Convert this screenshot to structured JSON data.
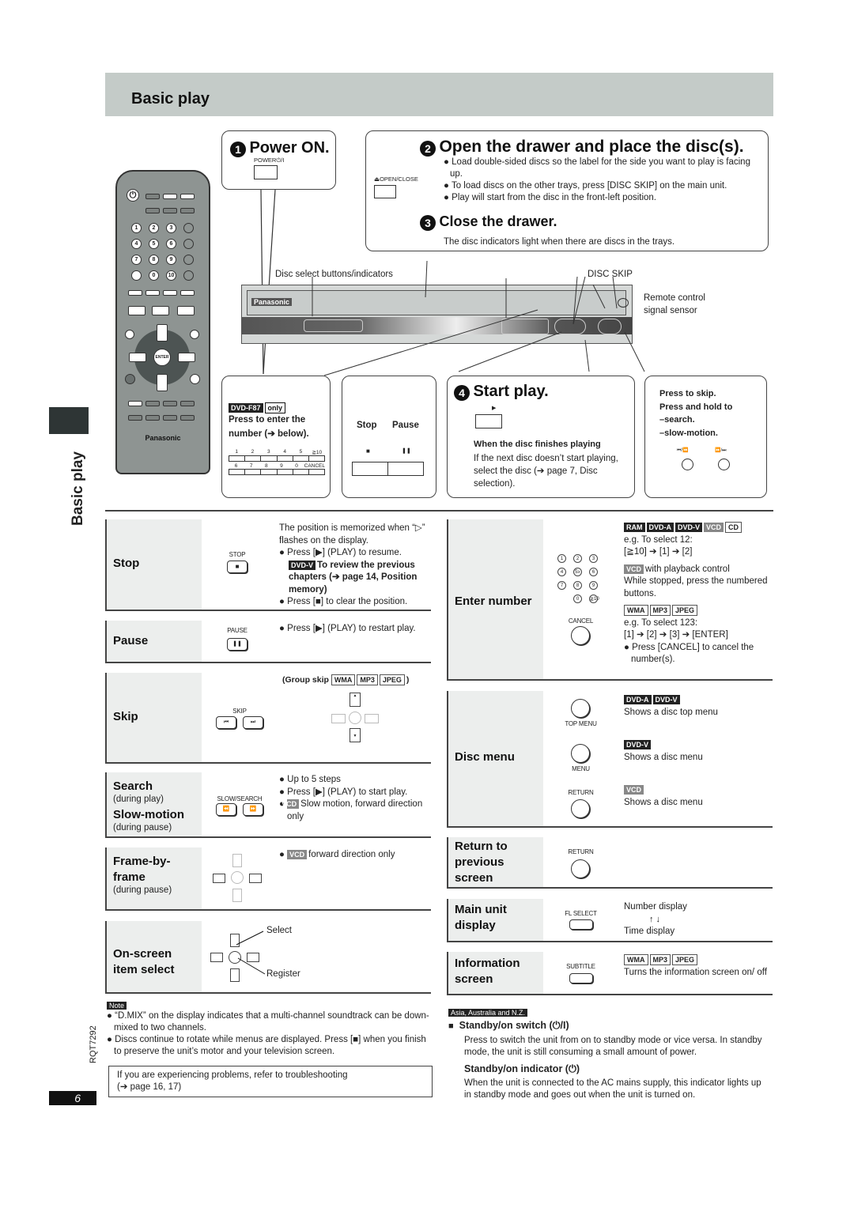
{
  "header": {
    "title": "Basic play"
  },
  "side_tab": {
    "label": "Basic play",
    "doc_code": "RQT7292",
    "page_number": "6"
  },
  "remote": {
    "brand": "Panasonic",
    "enter_label": "ENTER"
  },
  "step1": {
    "num": "1",
    "title": "Power ON.",
    "button_label": "POWER⏻/I"
  },
  "step2": {
    "num": "2",
    "title": "Open the drawer and place the disc(s).",
    "button_label": "⏏OPEN/CLOSE",
    "bullets": [
      "Load double-sided discs so the label for the side you want to play is facing up.",
      "To load discs on the other trays, press [DISC SKIP] on the main unit.",
      "Play will start from the disc in the front-left position."
    ]
  },
  "step3": {
    "num": "3",
    "title": "Close the drawer.",
    "text": "The disc indicators light when there are discs in the trays."
  },
  "unit": {
    "disc_select_label": "Disc select buttons/indicators",
    "disc_skip_label": "DISC SKIP",
    "sensor_label_1": "Remote control",
    "sensor_label_2": "signal sensor",
    "brand": "Panasonic"
  },
  "callout_number": {
    "model_tag": "DVD-F87",
    "only": "only",
    "text1": "Press to enter the",
    "text2": "number (➔ below).",
    "row1": [
      "1",
      "2",
      "3",
      "4",
      "5",
      "≧10"
    ],
    "row2": [
      "6",
      "7",
      "8",
      "9",
      "0",
      "CANCEL"
    ]
  },
  "callout_stop_pause": {
    "stop": "Stop",
    "pause": "Pause",
    "stop_icon": "■",
    "pause_icon": "❚❚"
  },
  "step4": {
    "num": "4",
    "title": "Start play.",
    "play_icon": "▶",
    "finish_title": "When the disc finishes playing",
    "finish_text": "If the next disc doesn’t start playing, select the disc (➔ page 7, Disc selection)."
  },
  "callout_skip": {
    "line1": "Press to skip.",
    "line2": "Press and hold to",
    "line3": "–search.",
    "line4": "–slow-motion.",
    "left_icon": "⏮/⏪",
    "right_icon": "⏩/⏭"
  },
  "left_table": [
    {
      "label": "Stop",
      "button": "STOP",
      "icon": "■",
      "text": [
        "The position is memorized when “▷” flashes on the display.",
        "Press [▶] (PLAY) to resume.",
        "To review the previous chapters (➔ page 14, Position memory)",
        "Press [■] to clear the position."
      ],
      "tag": "DVD-V"
    },
    {
      "label": "Pause",
      "button": "PAUSE",
      "icon": "❚❚",
      "text": [
        "Press [▶] (PLAY) to restart play."
      ]
    },
    {
      "label": "Skip",
      "button": "SKIP",
      "icons": [
        "⏮",
        "⏭"
      ],
      "group_skip": "(Group skip",
      "tags": [
        "WMA",
        "MP3",
        "JPEG"
      ],
      "close": ")"
    },
    {
      "label": "Search",
      "sub": "(during play)",
      "label2": "Slow-motion",
      "sub2": "(during pause)",
      "button": "SLOW/SEARCH",
      "icons": [
        "⏪",
        "⏩"
      ],
      "text": [
        "Up to 5 steps",
        "Press [▶] (PLAY) to start play.",
        "Slow motion, forward direction only"
      ],
      "tag": "VCD"
    },
    {
      "label": "Frame-by-frame",
      "sub": "(during pause)",
      "text": [
        "forward direction only"
      ],
      "tag": "VCD"
    },
    {
      "label": "On-screen item select",
      "select": "Select",
      "register": "Register"
    }
  ],
  "right_table": [
    {
      "label": "Enter number",
      "cancel": "CANCEL",
      "tags1": [
        "RAM",
        "DVD-A",
        "DVD-V",
        "VCD",
        "CD"
      ],
      "ex1": "e.g. To select 12:",
      "seq1": "[≧10] ➔ [1] ➔ [2]",
      "tag2": "VCD",
      "pbc": "with playback control",
      "pbc2": "While stopped, press the numbered buttons.",
      "tags3": [
        "WMA",
        "MP3",
        "JPEG"
      ],
      "ex2": "e.g. To select 123:",
      "seq2": "[1] ➔ [2] ➔ [3] ➔ [ENTER]",
      "cancel_text": "Press [CANCEL] to cancel the number(s).",
      "keys": [
        "1",
        "2",
        "3",
        "4",
        "5≥",
        "6",
        "7",
        "8",
        "9",
        "0",
        "≧10"
      ]
    },
    {
      "label": "Disc menu",
      "items": [
        {
          "button": "TOP MENU",
          "tags": [
            "DVD-A",
            "DVD-V"
          ],
          "text": "Shows a disc top menu"
        },
        {
          "button": "MENU",
          "tags": [
            "DVD-V"
          ],
          "text": "Shows a disc menu"
        },
        {
          "button": "RETURN",
          "tags": [
            "VCD"
          ],
          "text": "Shows a disc menu"
        }
      ]
    },
    {
      "label": "Return to previous screen",
      "button": "RETURN"
    },
    {
      "label": "Main unit display",
      "button": "FL SELECT",
      "line1": "Number display",
      "arrows": "↑ ↓",
      "line2": "Time display"
    },
    {
      "label": "Information screen",
      "button": "SUBTITLE",
      "tags": [
        "WMA",
        "MP3",
        "JPEG"
      ],
      "text": "Turns the information screen on/ off"
    }
  ],
  "note": {
    "label": "Note",
    "bullets": [
      "“D.MIX” on the display indicates that a multi-channel soundtrack can be down-mixed to two channels.",
      "Discs continue to rotate while menus are displayed. Press [■] when you finish to preserve the unit’s motor and your television screen."
    ]
  },
  "troubleshoot": {
    "text1": "If you are experiencing problems, refer to troubleshooting",
    "text2": "(➔ page 16, 17)"
  },
  "standby": {
    "region": "Asia, Australia and N.Z.",
    "switch_title": "Standby/on switch (⏻/I)",
    "switch_text": "Press to switch the unit from on to standby mode or vice versa. In standby mode, the unit is still consuming a small amount of power.",
    "indicator_title": "Standby/on indicator (⏻)",
    "indicator_text": "When the unit is connected to the AC mains supply, this indicator lights up in standby mode and goes out when the unit is turned on."
  }
}
